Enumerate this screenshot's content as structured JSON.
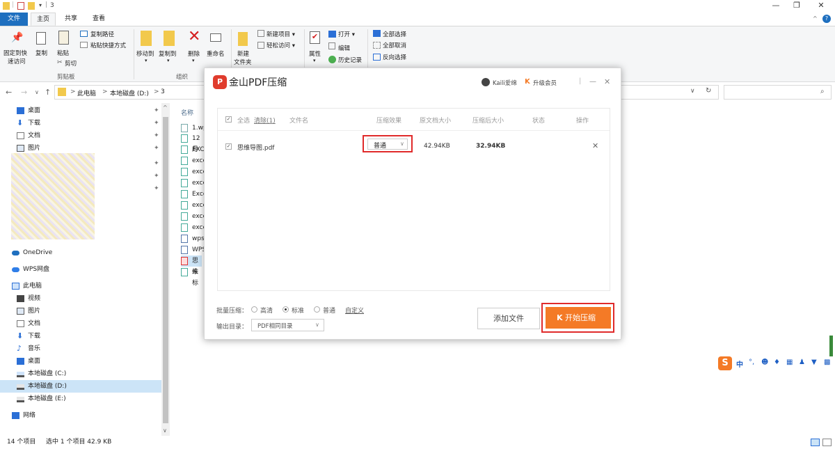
{
  "window": {
    "path_title": "3",
    "minimize": "—",
    "maximize": "❐",
    "close": "✕"
  },
  "ribbon_tabs": {
    "file": "文件",
    "home": "主页",
    "share": "共享",
    "view": "查看"
  },
  "ribbon": {
    "pin_quick": "固定到快\n速访问",
    "pin_quick_l1": "固定到快",
    "pin_quick_l2": "速访问",
    "copy": "复制",
    "paste": "粘贴",
    "copy_path": "复制路径",
    "paste_shortcut": "粘贴快捷方式",
    "cut": "剪切",
    "clipboard_group": "剪贴板",
    "move_to": "移动到",
    "copy_to": "复制到",
    "delete": "删除",
    "rename": "重命名",
    "organize_group": "组织",
    "new_item": "新建项目",
    "easy_access": "轻松访问",
    "new_folder_l1": "新建",
    "new_folder_l2": "文件夹",
    "properties": "属性",
    "open": "打开",
    "edit": "编辑",
    "history": "历史记录",
    "select_all": "全部选择",
    "select_none": "全部取消",
    "invert_select": "反向选择"
  },
  "address": {
    "crumbs": [
      "此电脑",
      "本地磁盘 (D:)",
      "3"
    ],
    "sep": ">"
  },
  "nav": {
    "quick": [
      {
        "label": "桌面",
        "icon": "desktop-icon"
      },
      {
        "label": "下载",
        "icon": "download-icon"
      },
      {
        "label": "文档",
        "icon": "document-icon"
      },
      {
        "label": "图片",
        "icon": "picture-icon"
      }
    ],
    "onedrive": "OneDrive",
    "wps": "WPS网盘",
    "thispc": "此电脑",
    "pc_items": [
      {
        "label": "视频",
        "icon": "video-icon"
      },
      {
        "label": "图片",
        "icon": "picture-icon"
      },
      {
        "label": "文档",
        "icon": "document-icon"
      },
      {
        "label": "下载",
        "icon": "download-icon"
      },
      {
        "label": "音乐",
        "icon": "music-icon"
      },
      {
        "label": "桌面",
        "icon": "desktop-icon"
      },
      {
        "label": "本地磁盘 (C:)",
        "icon": "drive-icon"
      },
      {
        "label": "本地磁盘 (D:)",
        "icon": "drive-icon"
      },
      {
        "label": "本地磁盘 (E:)",
        "icon": "drive-icon"
      }
    ],
    "network": "网络"
  },
  "files": {
    "header": "名称",
    "items": [
      "1.wp",
      "12月",
      "EXC",
      "exce",
      "exce",
      "exce",
      "Exce",
      "exce",
      "exce",
      "exce",
      "wps",
      "WPS",
      "思维",
      "未标"
    ]
  },
  "status": {
    "count": "14 个项目",
    "selected": "选中 1 个项目  42.9 KB"
  },
  "dialog": {
    "title": "金山PDF压缩",
    "user": "Kaili爱绵",
    "upgrade": "升级会员",
    "minimize": "—",
    "close": "✕",
    "table": {
      "select_all": "全选",
      "clear": "清除(1)",
      "col_filename": "文件名",
      "col_effect": "压缩效果",
      "col_orig": "原文档大小",
      "col_after": "压缩后大小",
      "col_status": "状态",
      "col_op": "操作",
      "row": {
        "filename": "思维导图.pdf",
        "effect": "普通",
        "orig": "42.94KB",
        "after": "32.94KB",
        "remove": "✕"
      }
    },
    "batch_label": "批量压缩：",
    "opt_hd": "高清",
    "opt_std": "标准",
    "opt_normal": "普通",
    "custom": "自定义",
    "output_label": "输出目录：",
    "output_value": "PDF相同目录",
    "add_file": "添加文件",
    "start": "开始压缩"
  },
  "colors": {
    "accent_orange": "#f47a26",
    "highlight_red": "#e02a2a",
    "explorer_blue": "#1e6fbf"
  }
}
